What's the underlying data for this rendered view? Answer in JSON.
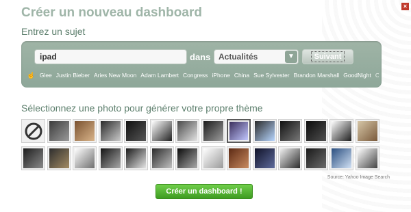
{
  "dialog": {
    "title": "Créer un nouveau dashboard",
    "close_icon": "close-icon"
  },
  "subject": {
    "label": "Entrez un sujet",
    "input_value": "ipad",
    "in_label": "dans",
    "category_selected": "Actualités",
    "next_label": "Suivant"
  },
  "tags": [
    "Glee",
    "Justin Bieber",
    "Aries New Moon",
    "Adam Lambert",
    "Congress",
    "iPhone",
    "China",
    "Sue Sylvester",
    "Brandon Marshall",
    "GoodNight",
    "Cats Love iPad"
  ],
  "photos": {
    "label": "Sélectionnez une photo pour générer votre propre thème",
    "count": 28,
    "selected_index": 8,
    "source": "Source: Yahoo Image Search"
  },
  "actions": {
    "create_label": "Créer un dashboard !"
  },
  "colors": {
    "accent": "#4ab02a",
    "panel": "#97ad9f",
    "title": "#9fb5a8",
    "subtitle": "#5d7f6d"
  }
}
